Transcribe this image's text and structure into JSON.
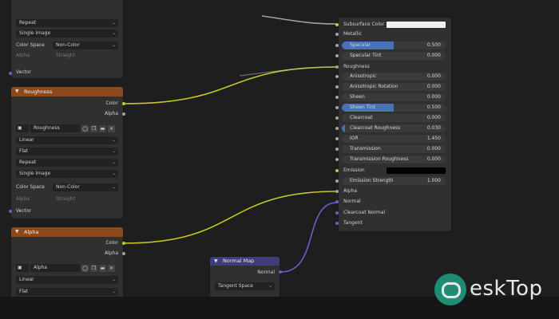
{
  "tex_top": {
    "extension": "Repeat",
    "source": "Single Image",
    "color_space_label": "Color Space",
    "color_space_value": "Non-Color",
    "alpha_label": "Alpha",
    "alpha_value": "Straight",
    "vector_label": "Vector"
  },
  "roughness_node": {
    "title": "Roughness",
    "out_color": "Color",
    "out_alpha": "Alpha",
    "image_name": "Roughness",
    "interpolation": "Linear",
    "projection": "Flat",
    "extension": "Repeat",
    "source": "Single Image",
    "color_space_label": "Color Space",
    "color_space_value": "Non-Color",
    "alpha_label": "Alpha",
    "alpha_value": "Straight",
    "vector_label": "Vector"
  },
  "alpha_node": {
    "title": "Alpha",
    "out_color": "Color",
    "out_alpha": "Alpha",
    "image_name": "Alpha",
    "interpolation": "Linear",
    "projection": "Flat"
  },
  "normal_map": {
    "title": "Normal Map",
    "out_normal": "Normal",
    "space": "Tangent Space"
  },
  "bsdf": {
    "subsurface_color_label": "Subsurface Color",
    "metallic_label": "Metallic",
    "roughness_label": "Roughness",
    "emission_label": "Emission",
    "alpha_label": "Alpha",
    "normal_label": "Normal",
    "clearcoat_normal_label": "Clearcoat Normal",
    "tangent_label": "Tangent",
    "colors": {
      "subsurface": "#f2f2f2",
      "emission": "#000000",
      "slider_fill": "#4772b3"
    },
    "sliders_a": [
      {
        "label": "Specular",
        "value": "0.500",
        "fill": 0.5
      },
      {
        "label": "Specular Tint",
        "value": "0.000",
        "fill": 0
      }
    ],
    "sliders_b": [
      {
        "label": "Anisotropic",
        "value": "0.000",
        "fill": 0
      },
      {
        "label": "Anisotropic Rotation",
        "value": "0.000",
        "fill": 0
      },
      {
        "label": "Sheen",
        "value": "0.000",
        "fill": 0
      },
      {
        "label": "Sheen Tint",
        "value": "0.500",
        "fill": 0.5
      },
      {
        "label": "Clearcoat",
        "value": "0.000",
        "fill": 0
      },
      {
        "label": "Clearcoat Roughness",
        "value": "0.030",
        "fill": 0.03
      },
      {
        "label": "IOR",
        "value": "1.450",
        "fill": 0
      },
      {
        "label": "Transmission",
        "value": "0.000",
        "fill": 0
      },
      {
        "label": "Transmission Roughness",
        "value": "0.000",
        "fill": 0
      }
    ],
    "emission_strength": {
      "label": "Emission Strength",
      "value": "1.000"
    }
  },
  "watermark": {
    "text": "eskTop"
  }
}
